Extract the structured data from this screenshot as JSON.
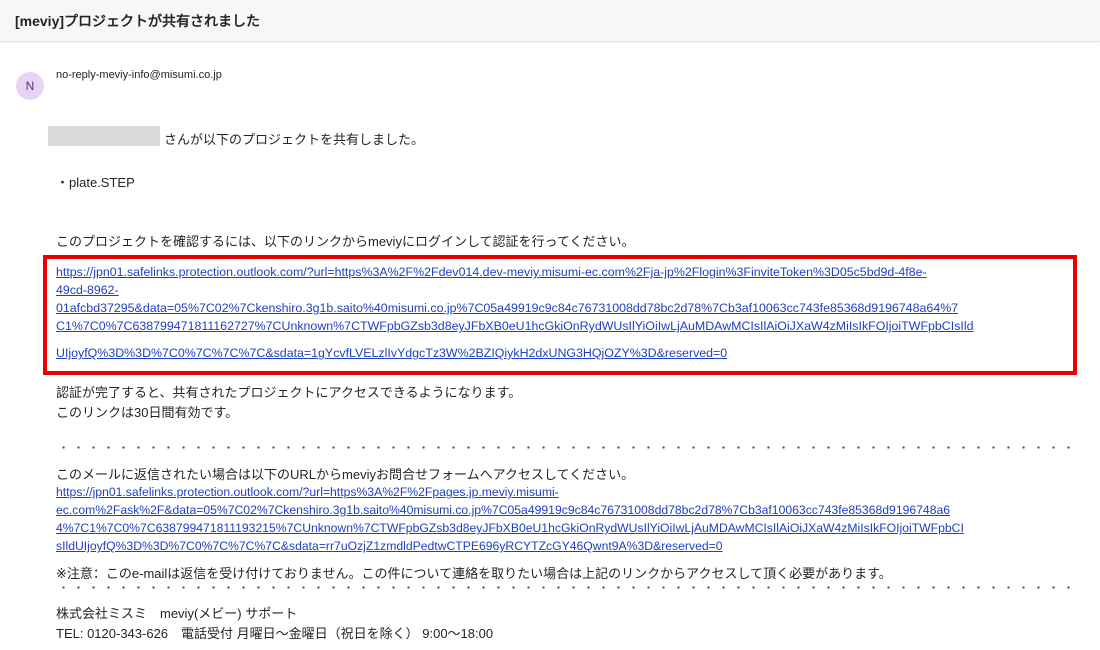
{
  "subject": "[meviy]プロジェクトが共有されました",
  "sender": {
    "initial": "N",
    "address": "no-reply-meviy-info@misumi.co.jp"
  },
  "body": {
    "shared_suffix": "さんが以下のプロジェクトを共有しました。",
    "project_item": "・plate.STEP",
    "instruction": "このプロジェクトを確認するには、以下のリンクからmeviyにログインして認証を行ってください。",
    "login_link_lines": [
      "https://jpn01.safelinks.protection.outlook.com/?url=https%3A%2F%2Fdev014.dev-meviy.misumi-ec.com%2Fja-jp%2Flogin%3FinviteToken%3D05c5bd9d-4f8e-",
      "49cd-8962-",
      "01afcbd37295&data=05%7C02%7Ckenshiro.3g1b.saito%40misumi.co.jp%7C05a49919c9c84c76731008dd78bc2d78%7Cb3af10063cc743fe85368d9196748a64%7",
      "C1%7C0%7C638799471811162727%7CUnknown%7CTWFpbGZsb3d8eyJFbXB0eU1hcGkiOnRydWUsIlYiOiIwLjAuMDAwMCIsIlAiOiJXaW4zMiIsIkFOIjoiTWFpbCIsIld",
      "UIjoyfQ%3D%3D%7C0%7C%7C%7C&sdata=1gYcvfLVELzlIvYdgcTz3W%2BZIQiykH2dxUNG3HQjOZY%3D&reserved=0"
    ],
    "after_auth": "認証が完了すると、共有されたプロジェクトにアクセスできるようになります。",
    "validity": "このリンクは30日間有効です。",
    "reply_instruction": "このメールに返信されたい場合は以下のURLからmeviyお問合せフォームへアクセスしてください。",
    "contact_link_lines": [
      "https://jpn01.safelinks.protection.outlook.com/?url=https%3A%2F%2Fpages.jp.meviy.misumi-",
      "ec.com%2Fask%2F&data=05%7C02%7Ckenshiro.3g1b.saito%40misumi.co.jp%7C05a49919c9c84c76731008dd78bc2d78%7Cb3af10063cc743fe85368d9196748a6",
      "4%7C1%7C0%7C638799471811193215%7CUnknown%7CTWFpbGZsb3d8eyJFbXB0eU1hcGkiOnRydWUsIlYiOiIwLjAuMDAwMCIsIlAiOiJXaW4zMiIsIkFOIjoiTWFpbCI",
      "sIldUIjoyfQ%3D%3D%7C0%7C%7C%7C&sdata=rr7uOzjZ1zmdldPedtwCTPE696yRCYTZcGY46Qwnt9A%3D&reserved=0"
    ],
    "notice": "※注意：このe-mailは返信を受け付けておりません。この件について連絡を取りたい場合は上記のリンクからアクセスして頂く必要があります。",
    "company": "株式会社ミスミ　meviy(メビー) サポート",
    "tel": "TEL: 0120-343-626　電話受付 月曜日～金曜日（祝日を除く） 9:00～18:00"
  }
}
